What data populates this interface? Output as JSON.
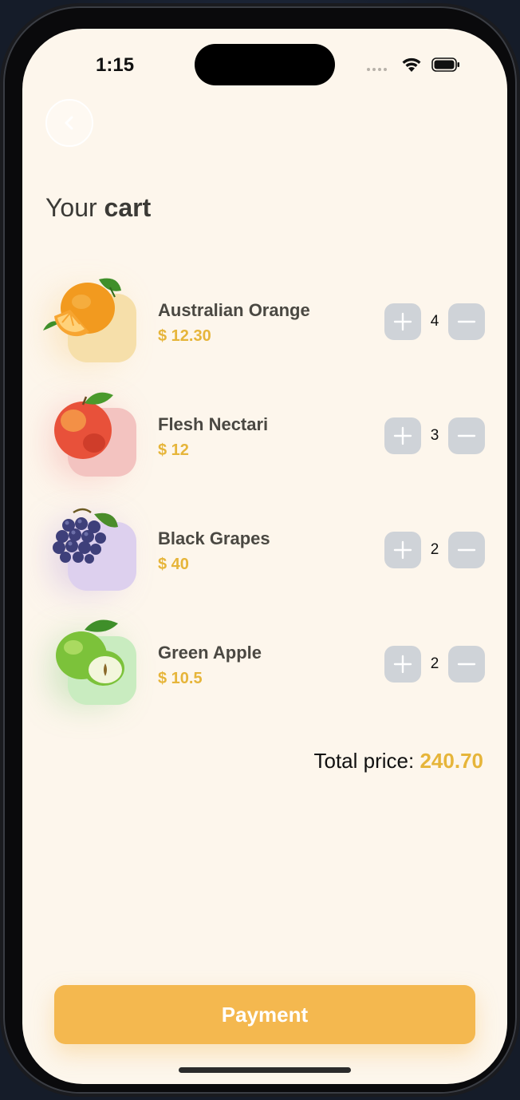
{
  "status_bar": {
    "time": "1:15"
  },
  "header": {
    "title_regular": "Your",
    "title_bold": "cart"
  },
  "items": [
    {
      "name": "Australian Orange",
      "price": "$ 12.30",
      "quantity": "4",
      "tile_color": "#f6dfaa",
      "fruit": "orange-image"
    },
    {
      "name": "Flesh Nectari",
      "price": "$ 12",
      "quantity": "3",
      "tile_color": "#f3c3c0",
      "fruit": "nectarine-image"
    },
    {
      "name": "Black Grapes",
      "price": "$ 40",
      "quantity": "2",
      "tile_color": "#ddd0ee",
      "fruit": "grapes-image"
    },
    {
      "name": "Green Apple",
      "price": "$ 10.5",
      "quantity": "2",
      "tile_color": "#c9ecc0",
      "fruit": "apple-image"
    }
  ],
  "total": {
    "label": "Total price:",
    "amount": "240.70"
  },
  "payment": {
    "label": "Payment"
  },
  "colors": {
    "accent": "#e6b53a",
    "button": "#f4b84f",
    "background": "#fdf6ec",
    "qty_button": "#cfd3d8"
  }
}
